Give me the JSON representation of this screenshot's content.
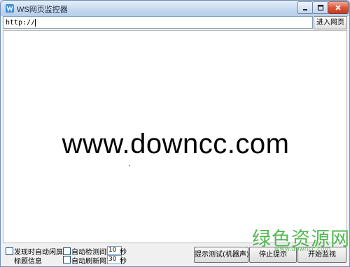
{
  "window": {
    "title": "WS网页监控器"
  },
  "address": {
    "value": "http://",
    "enter_label": "进入网页"
  },
  "content": {
    "big_text": "www.downcc.com"
  },
  "options": {
    "idle_screen_label": "发现时自动闲屏",
    "title_info_label": "标题信息",
    "auto_detect_label": "自动检测间隔",
    "auto_detect_value": "10",
    "auto_refresh_label": "自动刷新网页",
    "auto_refresh_value": "30",
    "seconds_label_1": "秒",
    "seconds_label_2": "秒"
  },
  "buttons": {
    "test_label": "提示测试(机器声)",
    "stop_label": "停止提示",
    "start_label": "开始监视"
  },
  "watermark": {
    "text": "绿色资源网",
    "sub": "www.downcc.com"
  },
  "colors": {
    "watermark": "#49b449",
    "close_button": "#d9563a"
  }
}
